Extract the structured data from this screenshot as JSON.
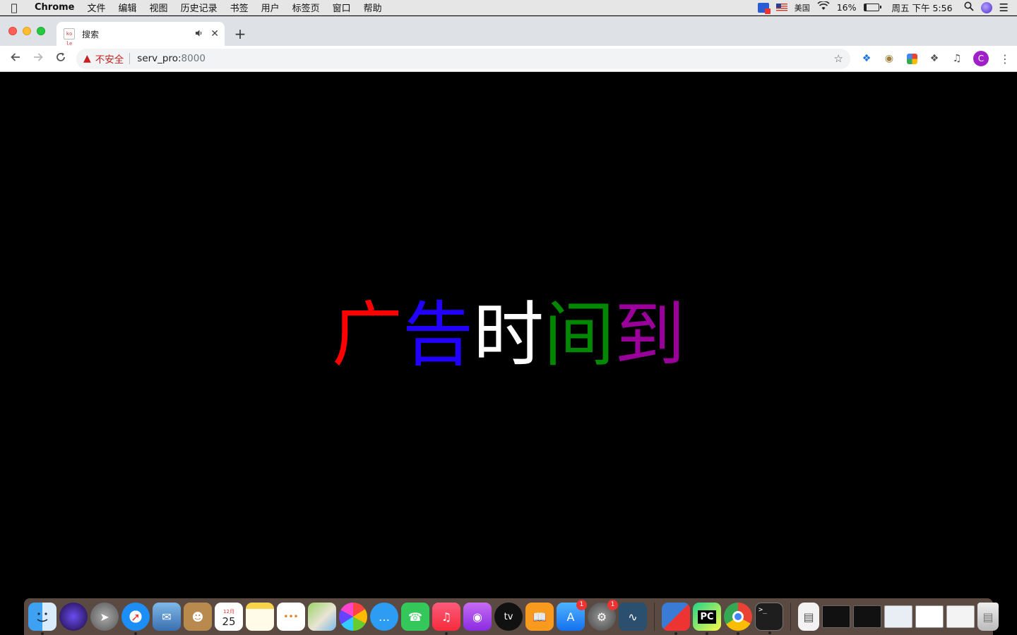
{
  "menubar": {
    "app_name": "Chrome",
    "menus": [
      "文件",
      "编辑",
      "视图",
      "历史记录",
      "书签",
      "用户",
      "标签页",
      "窗口",
      "帮助"
    ],
    "input_source": "美国",
    "battery_percent": "16%",
    "battery_level": 0.16,
    "clock": "周五 下午 5:56"
  },
  "tab": {
    "title": "搜索",
    "favicon_text": "ko le"
  },
  "toolbar": {
    "security_label": "不安全",
    "url_host": "serv_pro:",
    "url_port": "8000",
    "profile_initial": "C"
  },
  "page": {
    "chars": [
      {
        "text": "广",
        "color": "#ff0000"
      },
      {
        "text": "告",
        "color": "#2200ff"
      },
      {
        "text": "时",
        "color": "#ffffff"
      },
      {
        "text": "间",
        "color": "#008800"
      },
      {
        "text": "到",
        "color": "#990099"
      }
    ]
  },
  "dock": {
    "calendar_month": "12月",
    "calendar_day": "25",
    "appstore_badge": "1",
    "settings_badge": "1",
    "tv_label": "tv",
    "pycharm_label": "PC"
  }
}
